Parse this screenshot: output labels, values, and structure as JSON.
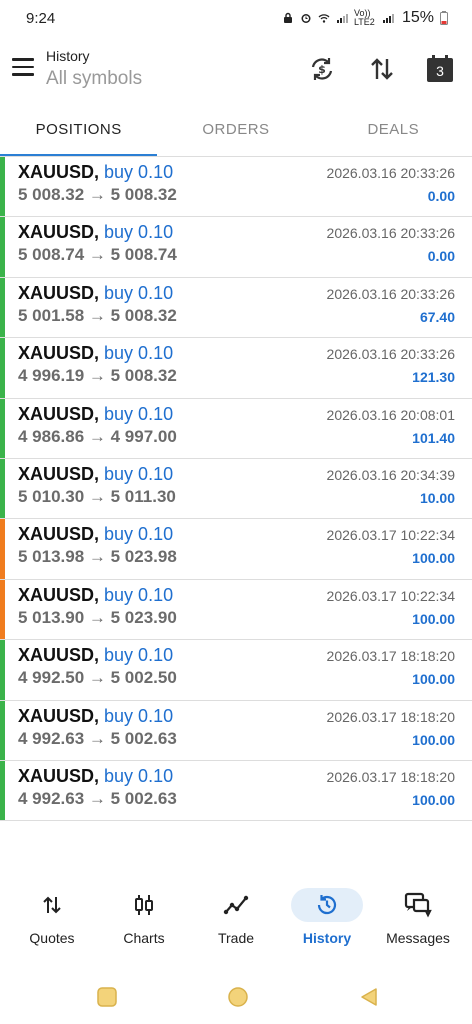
{
  "status_bar": {
    "time": "9:24",
    "network": "Vo)) LTE2",
    "battery": "15%"
  },
  "app_bar": {
    "subtitle": "History",
    "title": "All symbols",
    "icons": [
      "menu-icon",
      "sync-currency-icon",
      "sort-icon",
      "calendar-icon"
    ],
    "calendar_day": "3"
  },
  "tabs": [
    {
      "label": "POSITIONS",
      "active": true
    },
    {
      "label": "ORDERS",
      "active": false
    },
    {
      "label": "DEALS",
      "active": false
    }
  ],
  "colors": {
    "accent": "#1f6fcf",
    "bar_green": "#3bb34a",
    "bar_orange": "#f07c1e"
  },
  "positions": [
    {
      "symbol": "XAUUSD,",
      "side": "buy 0.10",
      "prices": "5 008.32 → 5 008.32",
      "time": "2026.03.16 20:33:26",
      "profit": "0.00",
      "bar": "#3bb34a"
    },
    {
      "symbol": "XAUUSD,",
      "side": "buy 0.10",
      "prices": "5 008.74 → 5 008.74",
      "time": "2026.03.16 20:33:26",
      "profit": "0.00",
      "bar": "#3bb34a"
    },
    {
      "symbol": "XAUUSD,",
      "side": "buy 0.10",
      "prices": "5 001.58 → 5 008.32",
      "time": "2026.03.16 20:33:26",
      "profit": "67.40",
      "bar": "#3bb34a"
    },
    {
      "symbol": "XAUUSD,",
      "side": "buy 0.10",
      "prices": "4 996.19 → 5 008.32",
      "time": "2026.03.16 20:33:26",
      "profit": "121.30",
      "bar": "#3bb34a"
    },
    {
      "symbol": "XAUUSD,",
      "side": "buy 0.10",
      "prices": "4 986.86 → 4 997.00",
      "time": "2026.03.16 20:08:01",
      "profit": "101.40",
      "bar": "#3bb34a"
    },
    {
      "symbol": "XAUUSD,",
      "side": "buy 0.10",
      "prices": "5 010.30 → 5 011.30",
      "time": "2026.03.16 20:34:39",
      "profit": "10.00",
      "bar": "#3bb34a"
    },
    {
      "symbol": "XAUUSD,",
      "side": "buy 0.10",
      "prices": "5 013.98 → 5 023.98",
      "time": "2026.03.17 10:22:34",
      "profit": "100.00",
      "bar": "#f07c1e"
    },
    {
      "symbol": "XAUUSD,",
      "side": "buy 0.10",
      "prices": "5 013.90 → 5 023.90",
      "time": "2026.03.17 10:22:34",
      "profit": "100.00",
      "bar": "#f07c1e"
    },
    {
      "symbol": "XAUUSD,",
      "side": "buy 0.10",
      "prices": "4 992.50 → 5 002.50",
      "time": "2026.03.17 18:18:20",
      "profit": "100.00",
      "bar": "#3bb34a"
    },
    {
      "symbol": "XAUUSD,",
      "side": "buy 0.10",
      "prices": "4 992.63 → 5 002.63",
      "time": "2026.03.17 18:18:20",
      "profit": "100.00",
      "bar": "#3bb34a"
    },
    {
      "symbol": "XAUUSD,",
      "side": "buy 0.10",
      "prices": "4 992.63 → 5 002.63",
      "time": "2026.03.17 18:18:20",
      "profit": "100.00",
      "bar": "#3bb34a"
    }
  ],
  "bottom_nav": [
    {
      "label": "Quotes",
      "icon": "quotes-arrows-icon",
      "active": false
    },
    {
      "label": "Charts",
      "icon": "candlestick-icon",
      "active": false
    },
    {
      "label": "Trade",
      "icon": "trade-line-icon",
      "active": false
    },
    {
      "label": "History",
      "icon": "history-clock-icon",
      "active": true
    },
    {
      "label": "Messages",
      "icon": "messages-icon",
      "active": false
    }
  ],
  "system_nav": [
    "recent-apps-icon",
    "home-icon",
    "back-icon"
  ]
}
